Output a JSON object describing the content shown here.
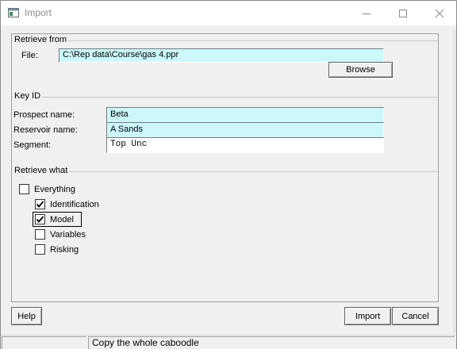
{
  "window": {
    "title": "Import",
    "icon": "app-window-icon",
    "minimize_icon": "minimize-icon",
    "maximize_icon": "maximize-icon",
    "close_icon": "close-icon"
  },
  "retrieve_from": {
    "group_label": "Retrieve from",
    "file_label": "File:",
    "file_value": "C:\\Rep data\\Course\\gas 4.ppr",
    "browse_label": "Browse"
  },
  "key_id": {
    "group_label": "Key ID",
    "prospect_label": "Prospect name:",
    "prospect_value": "Beta",
    "reservoir_label": "Reservoir name:",
    "reservoir_value": "A Sands",
    "segment_label": "Segment:",
    "segment_value": "Top Unc"
  },
  "retrieve_what": {
    "group_label": "Retrieve what",
    "options": [
      {
        "label": "Everything",
        "checked": false
      },
      {
        "label": "Identification",
        "checked": true
      },
      {
        "label": "Model",
        "checked": true
      },
      {
        "label": "Variables",
        "checked": false
      },
      {
        "label": "Risking",
        "checked": false
      }
    ]
  },
  "buttons": {
    "help": "Help",
    "import": "Import",
    "cancel": "Cancel"
  },
  "status": {
    "message": "Copy the whole caboodle"
  },
  "colors": {
    "field_highlight": "#ccf8fc",
    "background": "#f0f0f0"
  }
}
